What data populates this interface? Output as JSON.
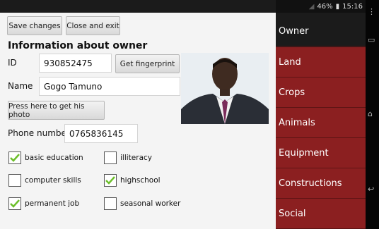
{
  "toolbar": {
    "save_label": "Save changes",
    "close_label": "Close and exit"
  },
  "section_title": "Information about owner",
  "id_field": {
    "label": "ID",
    "value": "930852475"
  },
  "fingerprint_button": "Get fingerprint",
  "name_field": {
    "label": "Name",
    "value": "Gogo Tamuno"
  },
  "photo_button": "Press here to get his photo",
  "phone_field": {
    "label": "Phone number",
    "value": "0765836145"
  },
  "checkboxes": [
    {
      "label": "basic education",
      "checked": true
    },
    {
      "label": "illiteracy",
      "checked": false
    },
    {
      "label": "computer skills",
      "checked": false
    },
    {
      "label": "highschool",
      "checked": true
    },
    {
      "label": "permanent job",
      "checked": true
    },
    {
      "label": "seasonal worker",
      "checked": false
    }
  ],
  "status_bar": {
    "battery": "46%",
    "time": "15:16"
  },
  "menu": [
    "Owner",
    "Land",
    "Crops",
    "Animals",
    "Equipment",
    "Constructions",
    "Social"
  ],
  "colors": {
    "menu_bg": "#8b1f20",
    "menu_active_bg": "#1b1b1b",
    "check": "#6cbf2a"
  }
}
